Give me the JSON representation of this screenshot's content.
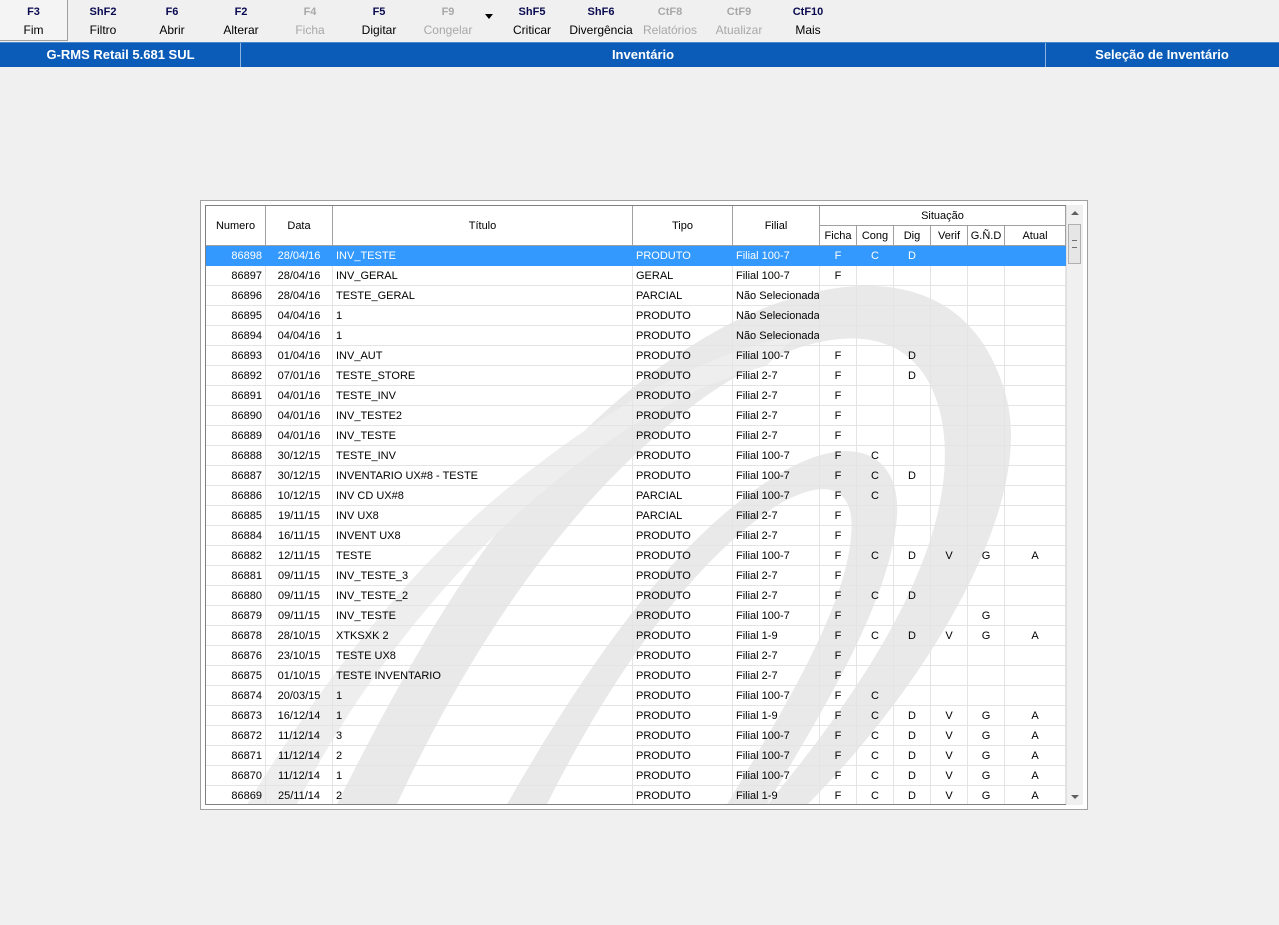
{
  "toolbar": {
    "buttons": [
      {
        "key": "F3",
        "label": "Fim",
        "enabled": true
      },
      {
        "key": "ShF2",
        "label": "Filtro",
        "enabled": true
      },
      {
        "key": "F6",
        "label": "Abrir",
        "enabled": true
      },
      {
        "key": "F2",
        "label": "Alterar",
        "enabled": true
      },
      {
        "key": "F4",
        "label": "Ficha",
        "enabled": false
      },
      {
        "key": "F5",
        "label": "Digitar",
        "enabled": true
      },
      {
        "key": "F9",
        "label": "Congelar",
        "enabled": false
      },
      {
        "key": "ShF5",
        "label": "Criticar",
        "enabled": true
      },
      {
        "key": "ShF6",
        "label": "Divergência",
        "enabled": true
      },
      {
        "key": "CtF8",
        "label": "Relatórios",
        "enabled": false
      },
      {
        "key": "CtF9",
        "label": "Atualizar",
        "enabled": false
      },
      {
        "key": "CtF10",
        "label": "Mais",
        "enabled": true
      }
    ]
  },
  "titlebar": {
    "app": "G-RMS Retail 5.681 SUL",
    "module": "Inventário",
    "screen": "Seleção de Inventário"
  },
  "grid": {
    "headers": {
      "numero": "Numero",
      "data": "Data",
      "titulo": "Título",
      "tipo": "Tipo",
      "filial": "Filial",
      "situacao": "Situação",
      "ficha": "Ficha",
      "cong": "Cong",
      "dig": "Dig",
      "verif": "Verif",
      "gnd": "G.Ñ.D",
      "atual": "Atual"
    },
    "selected_index": 0,
    "rows": [
      {
        "numero": "86898",
        "data": "28/04/16",
        "titulo": "INV_TESTE",
        "tipo": "PRODUTO",
        "filial": "Filial 100-7",
        "ficha": "F",
        "cong": "C",
        "dig": "D",
        "verif": "",
        "gnd": "",
        "atual": ""
      },
      {
        "numero": "86897",
        "data": "28/04/16",
        "titulo": "INV_GERAL",
        "tipo": "GERAL",
        "filial": "Filial 100-7",
        "ficha": "F",
        "cong": "",
        "dig": "",
        "verif": "",
        "gnd": "",
        "atual": ""
      },
      {
        "numero": "86896",
        "data": "28/04/16",
        "titulo": "TESTE_GERAL",
        "tipo": "PARCIAL",
        "filial": "Não Selecionada",
        "ficha": "",
        "cong": "",
        "dig": "",
        "verif": "",
        "gnd": "",
        "atual": ""
      },
      {
        "numero": "86895",
        "data": "04/04/16",
        "titulo": "1",
        "tipo": "PRODUTO",
        "filial": "Não Selecionada",
        "ficha": "",
        "cong": "",
        "dig": "",
        "verif": "",
        "gnd": "",
        "atual": ""
      },
      {
        "numero": "86894",
        "data": "04/04/16",
        "titulo": "1",
        "tipo": "PRODUTO",
        "filial": "Não Selecionada",
        "ficha": "",
        "cong": "",
        "dig": "",
        "verif": "",
        "gnd": "",
        "atual": ""
      },
      {
        "numero": "86893",
        "data": "01/04/16",
        "titulo": "INV_AUT",
        "tipo": "PRODUTO",
        "filial": "Filial 100-7",
        "ficha": "F",
        "cong": "",
        "dig": "D",
        "verif": "",
        "gnd": "",
        "atual": ""
      },
      {
        "numero": "86892",
        "data": "07/01/16",
        "titulo": "TESTE_STORE",
        "tipo": "PRODUTO",
        "filial": "Filial 2-7",
        "ficha": "F",
        "cong": "",
        "dig": "D",
        "verif": "",
        "gnd": "",
        "atual": ""
      },
      {
        "numero": "86891",
        "data": "04/01/16",
        "titulo": "TESTE_INV",
        "tipo": "PRODUTO",
        "filial": "Filial 2-7",
        "ficha": "F",
        "cong": "",
        "dig": "",
        "verif": "",
        "gnd": "",
        "atual": ""
      },
      {
        "numero": "86890",
        "data": "04/01/16",
        "titulo": "INV_TESTE2",
        "tipo": "PRODUTO",
        "filial": "Filial 2-7",
        "ficha": "F",
        "cong": "",
        "dig": "",
        "verif": "",
        "gnd": "",
        "atual": ""
      },
      {
        "numero": "86889",
        "data": "04/01/16",
        "titulo": "INV_TESTE",
        "tipo": "PRODUTO",
        "filial": "Filial 2-7",
        "ficha": "F",
        "cong": "",
        "dig": "",
        "verif": "",
        "gnd": "",
        "atual": ""
      },
      {
        "numero": "86888",
        "data": "30/12/15",
        "titulo": "TESTE_INV",
        "tipo": "PRODUTO",
        "filial": "Filial 100-7",
        "ficha": "F",
        "cong": "C",
        "dig": "",
        "verif": "",
        "gnd": "",
        "atual": ""
      },
      {
        "numero": "86887",
        "data": "30/12/15",
        "titulo": "INVENTARIO UX#8 - TESTE",
        "tipo": "PRODUTO",
        "filial": "Filial 100-7",
        "ficha": "F",
        "cong": "C",
        "dig": "D",
        "verif": "",
        "gnd": "",
        "atual": ""
      },
      {
        "numero": "86886",
        "data": "10/12/15",
        "titulo": "INV CD UX#8",
        "tipo": "PARCIAL",
        "filial": "Filial 100-7",
        "ficha": "F",
        "cong": "C",
        "dig": "",
        "verif": "",
        "gnd": "",
        "atual": ""
      },
      {
        "numero": "86885",
        "data": "19/11/15",
        "titulo": "INV UX8",
        "tipo": "PARCIAL",
        "filial": "Filial 2-7",
        "ficha": "F",
        "cong": "",
        "dig": "",
        "verif": "",
        "gnd": "",
        "atual": ""
      },
      {
        "numero": "86884",
        "data": "16/11/15",
        "titulo": "INVENT UX8",
        "tipo": "PRODUTO",
        "filial": "Filial 2-7",
        "ficha": "F",
        "cong": "",
        "dig": "",
        "verif": "",
        "gnd": "",
        "atual": ""
      },
      {
        "numero": "86882",
        "data": "12/11/15",
        "titulo": "TESTE",
        "tipo": "PRODUTO",
        "filial": "Filial 100-7",
        "ficha": "F",
        "cong": "C",
        "dig": "D",
        "verif": "V",
        "gnd": "G",
        "atual": "A"
      },
      {
        "numero": "86881",
        "data": "09/11/15",
        "titulo": "INV_TESTE_3",
        "tipo": "PRODUTO",
        "filial": "Filial 2-7",
        "ficha": "F",
        "cong": "",
        "dig": "",
        "verif": "",
        "gnd": "",
        "atual": ""
      },
      {
        "numero": "86880",
        "data": "09/11/15",
        "titulo": "INV_TESTE_2",
        "tipo": "PRODUTO",
        "filial": "Filial 2-7",
        "ficha": "F",
        "cong": "C",
        "dig": "D",
        "verif": "",
        "gnd": "",
        "atual": ""
      },
      {
        "numero": "86879",
        "data": "09/11/15",
        "titulo": "INV_TESTE",
        "tipo": "PRODUTO",
        "filial": "Filial 100-7",
        "ficha": "F",
        "cong": "",
        "dig": "",
        "verif": "",
        "gnd": "G",
        "atual": ""
      },
      {
        "numero": "86878",
        "data": "28/10/15",
        "titulo": "XTKSXK 2",
        "tipo": "PRODUTO",
        "filial": "Filial 1-9",
        "ficha": "F",
        "cong": "C",
        "dig": "D",
        "verif": "V",
        "gnd": "G",
        "atual": "A"
      },
      {
        "numero": "86876",
        "data": "23/10/15",
        "titulo": "TESTE UX8",
        "tipo": "PRODUTO",
        "filial": "Filial 2-7",
        "ficha": "F",
        "cong": "",
        "dig": "",
        "verif": "",
        "gnd": "",
        "atual": ""
      },
      {
        "numero": "86875",
        "data": "01/10/15",
        "titulo": "TESTE INVENTARIO",
        "tipo": "PRODUTO",
        "filial": "Filial 2-7",
        "ficha": "F",
        "cong": "",
        "dig": "",
        "verif": "",
        "gnd": "",
        "atual": ""
      },
      {
        "numero": "86874",
        "data": "20/03/15",
        "titulo": "1",
        "tipo": "PRODUTO",
        "filial": "Filial 100-7",
        "ficha": "F",
        "cong": "C",
        "dig": "",
        "verif": "",
        "gnd": "",
        "atual": ""
      },
      {
        "numero": "86873",
        "data": "16/12/14",
        "titulo": "1",
        "tipo": "PRODUTO",
        "filial": "Filial 1-9",
        "ficha": "F",
        "cong": "C",
        "dig": "D",
        "verif": "V",
        "gnd": "G",
        "atual": "A"
      },
      {
        "numero": "86872",
        "data": "11/12/14",
        "titulo": "3",
        "tipo": "PRODUTO",
        "filial": "Filial 100-7",
        "ficha": "F",
        "cong": "C",
        "dig": "D",
        "verif": "V",
        "gnd": "G",
        "atual": "A"
      },
      {
        "numero": "86871",
        "data": "11/12/14",
        "titulo": "2",
        "tipo": "PRODUTO",
        "filial": "Filial 100-7",
        "ficha": "F",
        "cong": "C",
        "dig": "D",
        "verif": "V",
        "gnd": "G",
        "atual": "A"
      },
      {
        "numero": "86870",
        "data": "11/12/14",
        "titulo": "1",
        "tipo": "PRODUTO",
        "filial": "Filial 100-7",
        "ficha": "F",
        "cong": "C",
        "dig": "D",
        "verif": "V",
        "gnd": "G",
        "atual": "A"
      },
      {
        "numero": "86869",
        "data": "25/11/14",
        "titulo": "2",
        "tipo": "PRODUTO",
        "filial": "Filial 1-9",
        "ficha": "F",
        "cong": "C",
        "dig": "D",
        "verif": "V",
        "gnd": "G",
        "atual": "A"
      }
    ]
  }
}
